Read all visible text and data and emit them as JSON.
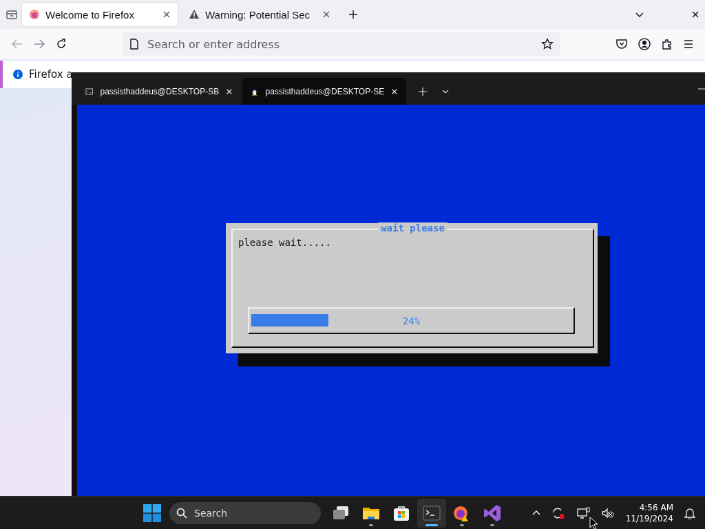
{
  "browser": {
    "tabs": [
      {
        "title": "Welcome to Firefox",
        "kind": "firefox",
        "selected": true
      },
      {
        "title": "Warning: Potential Sec",
        "kind": "warning",
        "selected": false
      }
    ],
    "address_bar": {
      "placeholder": "Search or enter address"
    },
    "notification": {
      "text": "Firefox a"
    }
  },
  "terminal": {
    "tabs": [
      {
        "title": "passisthaddeus@DESKTOP-SB",
        "kind": "cmd",
        "selected": false
      },
      {
        "title": "passisthaddeus@DESKTOP-SE",
        "kind": "linux",
        "selected": true
      }
    ],
    "dialog": {
      "title": "wait please",
      "message": "please wait.....",
      "progress": {
        "level": 0.24,
        "label": "24%"
      }
    }
  },
  "taskbar": {
    "search": {
      "placeholder": "Search"
    },
    "apps": [
      {
        "kind": "task-view",
        "running": false,
        "selected": false
      },
      {
        "kind": "files",
        "running": true,
        "selected": false
      },
      {
        "kind": "store",
        "running": false,
        "selected": false
      },
      {
        "kind": "terminal",
        "running": true,
        "selected": true
      },
      {
        "kind": "firefox",
        "running": true,
        "selected": false
      },
      {
        "kind": "visual-studio",
        "running": true,
        "selected": false
      }
    ],
    "time": "4:56 AM",
    "date": "11/19/2024"
  }
}
